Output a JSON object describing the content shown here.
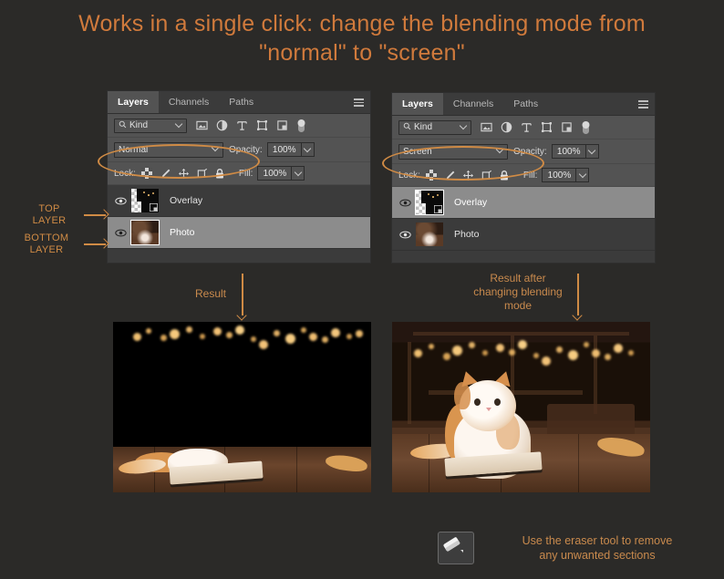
{
  "title": "Works in a single click: change the blending mode from\n\"normal\" to \"screen\"",
  "colors": {
    "background": "#2b2a28",
    "accent_orange": "#d08b45",
    "title_orange": "#d07a3c",
    "panel_bg": "#3b3b3b",
    "panel_body": "#535353",
    "selected_layer": "#8c8c8c"
  },
  "panels": [
    {
      "id": "before",
      "tabs": [
        {
          "label": "Layers",
          "active": true
        },
        {
          "label": "Channels",
          "active": false
        },
        {
          "label": "Paths",
          "active": false
        }
      ],
      "menu_icon": "hamburger-icon",
      "filter": {
        "kind_label": "Kind",
        "search_icon": "search-icon",
        "icons": [
          "pixel-layer-icon",
          "adjustment-layer-icon",
          "type-layer-icon",
          "shape-layer-icon",
          "smart-object-icon",
          "filter-toggle-icon"
        ]
      },
      "blend": {
        "mode": "Normal",
        "opacity_label": "Opacity:",
        "opacity_value": "100%"
      },
      "lock": {
        "label": "Lock:",
        "icons": [
          "lock-transparent-pixels-icon",
          "lock-image-pixels-icon",
          "lock-position-icon",
          "lock-artboard-nesting-icon",
          "lock-all-icon"
        ],
        "fill_label": "Fill:",
        "fill_value": "100%"
      },
      "layers": [
        {
          "name": "Overlay",
          "visible": true,
          "selected": false,
          "thumb": "overlay-transparent-thumb"
        },
        {
          "name": "Photo",
          "visible": true,
          "selected": true,
          "thumb": "photo-kitten-thumb"
        }
      ]
    },
    {
      "id": "after",
      "tabs": [
        {
          "label": "Layers",
          "active": true
        },
        {
          "label": "Channels",
          "active": false
        },
        {
          "label": "Paths",
          "active": false
        }
      ],
      "menu_icon": "hamburger-icon",
      "filter": {
        "kind_label": "Kind",
        "search_icon": "search-icon",
        "icons": [
          "pixel-layer-icon",
          "adjustment-layer-icon",
          "type-layer-icon",
          "shape-layer-icon",
          "smart-object-icon",
          "filter-toggle-icon"
        ]
      },
      "blend": {
        "mode": "Screen",
        "opacity_label": "Opacity:",
        "opacity_value": "100%"
      },
      "lock": {
        "label": "Lock:",
        "icons": [
          "lock-transparent-pixels-icon",
          "lock-image-pixels-icon",
          "lock-position-icon",
          "lock-artboard-nesting-icon",
          "lock-all-icon"
        ],
        "fill_label": "Fill:",
        "fill_value": "100%"
      },
      "layers": [
        {
          "name": "Overlay",
          "visible": true,
          "selected": true,
          "thumb": "overlay-transparent-thumb"
        },
        {
          "name": "Photo",
          "visible": true,
          "selected": false,
          "thumb": "photo-kitten-thumb"
        }
      ]
    }
  ],
  "annotations": {
    "top_layer": "TOP\nLAYER",
    "bottom_layer": "BOTTOM\nLAYER",
    "result_left": "Result",
    "result_right": "Result after\nchanging blending\nmode"
  },
  "footer": {
    "eraser_icon": "eraser-tool-icon",
    "note": "Use the eraser tool to remove\nany unwanted sections"
  }
}
